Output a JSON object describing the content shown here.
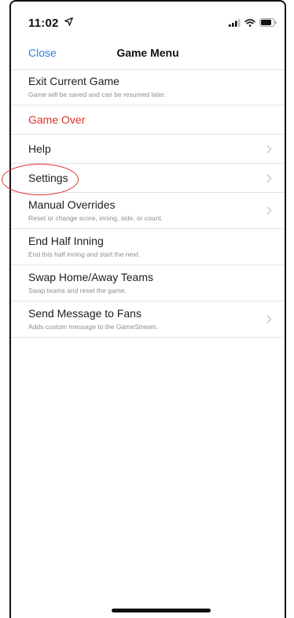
{
  "status_bar": {
    "time": "11:02",
    "location_icon": "location-arrow-icon",
    "signal_icon": "cellular-signal-icon",
    "wifi_icon": "wifi-icon",
    "battery_icon": "battery-icon"
  },
  "nav": {
    "close_label": "Close",
    "title": "Game Menu"
  },
  "menu": {
    "items": [
      {
        "title": "Exit Current Game",
        "subtitle": "Game will be saved and can be resumed later.",
        "has_chevron": false
      },
      {
        "title": "Game Over",
        "subtitle": "",
        "has_chevron": false
      },
      {
        "title": "Help",
        "subtitle": "",
        "has_chevron": true
      },
      {
        "title": "Settings",
        "subtitle": "",
        "has_chevron": true
      },
      {
        "title": "Manual Overrides",
        "subtitle": "Reset or change score, inning, side, or count.",
        "has_chevron": true
      },
      {
        "title": "End Half Inning",
        "subtitle": "End this half inning and start the next.",
        "has_chevron": false
      },
      {
        "title": "Swap Home/Away Teams",
        "subtitle": "Swap teams and reset the game.",
        "has_chevron": false
      },
      {
        "title": "Send Message to Fans",
        "subtitle": "Adds custom message to the GameStream.",
        "has_chevron": true
      }
    ]
  },
  "colors": {
    "accent": "#2f7fe0",
    "danger": "#d9342b",
    "annotation": "#e0312c",
    "separator": "#e4e4e6",
    "chevron": "#c7c7cc"
  }
}
